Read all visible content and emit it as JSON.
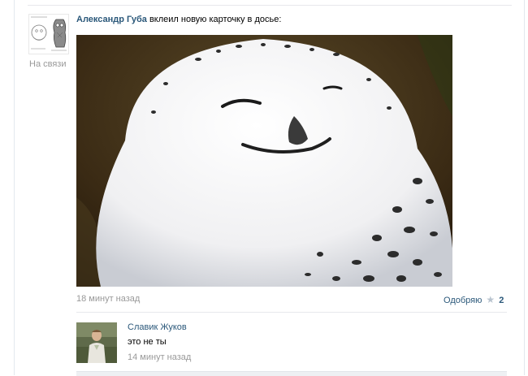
{
  "post": {
    "status": "На связи",
    "author": "Александр Губа",
    "action": "вклеил новую карточку в досье:",
    "timestamp": "18 минут назад",
    "like_label": "Одобряю",
    "like_count": "2"
  },
  "comment": {
    "author": "Славик Жуков",
    "text": "это не ты",
    "time": "14 минут назад"
  },
  "colors": {
    "link": "#2b587a",
    "muted": "#999999"
  },
  "icons": [
    "star-icon"
  ]
}
